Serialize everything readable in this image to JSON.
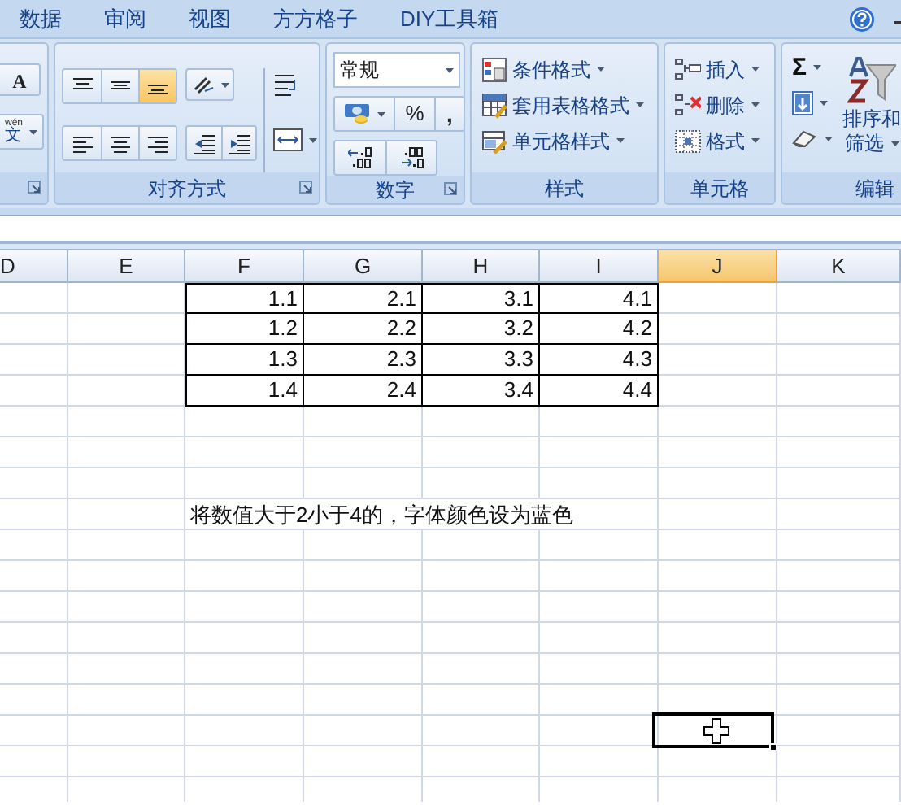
{
  "tabs": [
    {
      "label": "数据"
    },
    {
      "label": "审阅"
    },
    {
      "label": "视图"
    },
    {
      "label": "方方格子"
    },
    {
      "label": "DIY工具箱"
    }
  ],
  "ribbon": {
    "font": {
      "grow_button": "A",
      "phonetic_ruby": "wén",
      "phonetic_char": "文"
    },
    "alignment": {
      "title": "对齐方式",
      "vertical_align": [
        {
          "kind": "top",
          "selected": false
        },
        {
          "kind": "middle",
          "selected": false
        },
        {
          "kind": "bottom",
          "selected": true
        }
      ]
    },
    "number": {
      "title": "数字",
      "format": "常规",
      "percent": "%",
      "comma": ","
    },
    "styles": {
      "title": "样式",
      "items": [
        {
          "kind": "conditional",
          "label": "条件格式"
        },
        {
          "kind": "table",
          "label": "套用表格格式"
        },
        {
          "kind": "cellstyle",
          "label": "单元格样式"
        }
      ]
    },
    "cells": {
      "title": "单元格",
      "items": [
        {
          "kind": "insert",
          "label": "插入"
        },
        {
          "kind": "delete",
          "label": "删除"
        },
        {
          "kind": "format",
          "label": "格式"
        }
      ]
    },
    "editing": {
      "title": "编辑",
      "sum": "Σ",
      "sort_filter": [
        "排序和",
        "筛选"
      ]
    }
  },
  "sheet": {
    "columns": [
      {
        "label": "D",
        "selected": false
      },
      {
        "label": "E",
        "selected": false
      },
      {
        "label": "F",
        "selected": false
      },
      {
        "label": "G",
        "selected": false
      },
      {
        "label": "H",
        "selected": false
      },
      {
        "label": "I",
        "selected": false
      },
      {
        "label": "J",
        "selected": true
      },
      {
        "label": "K",
        "selected": false
      }
    ],
    "table": [
      [
        "1.1",
        "2.1",
        "3.1",
        "4.1"
      ],
      [
        "1.2",
        "2.2",
        "3.2",
        "4.2"
      ],
      [
        "1.3",
        "2.3",
        "3.3",
        "4.3"
      ],
      [
        "1.4",
        "2.4",
        "3.4",
        "4.4"
      ]
    ],
    "note": "将数值大于2小于4的，字体颜色设为蓝色"
  }
}
